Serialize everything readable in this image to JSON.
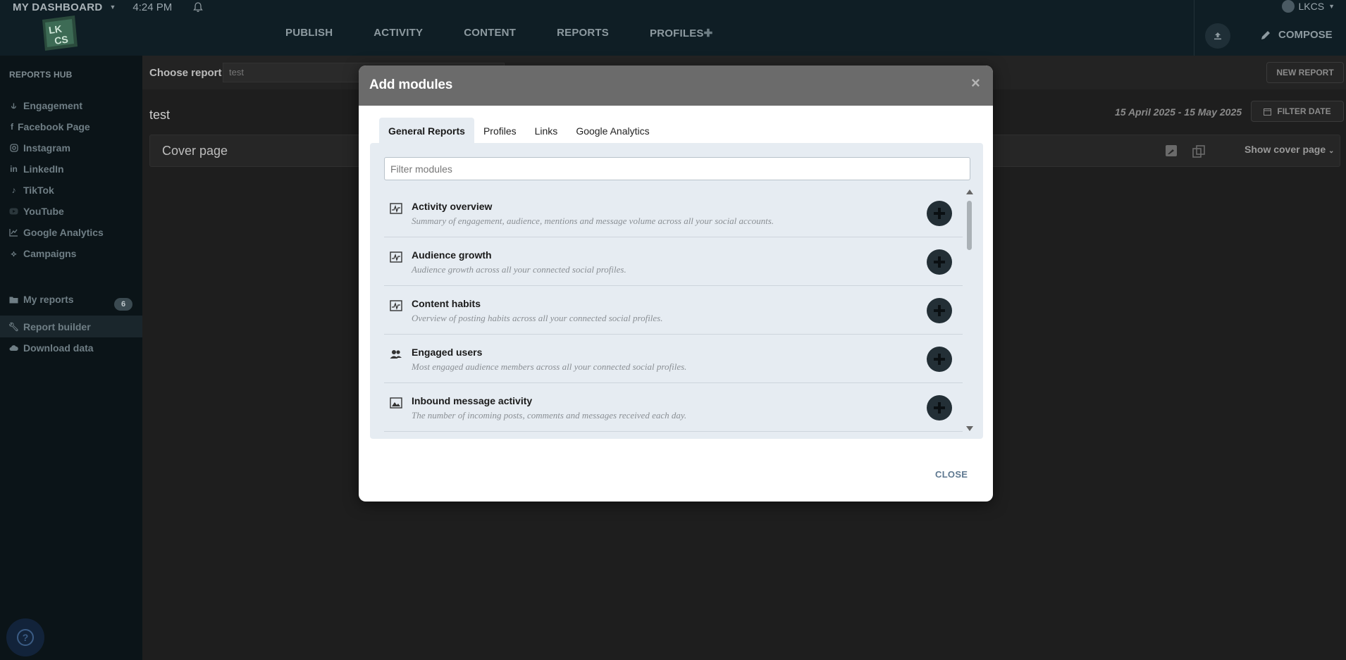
{
  "topbar": {
    "dashboard_label": "MY DASHBOARD",
    "time": "4:24 PM",
    "user": "LKCS",
    "compose_label": "COMPOSE",
    "nav": [
      {
        "label": "PUBLISH"
      },
      {
        "label": "ACTIVITY"
      },
      {
        "label": "CONTENT"
      },
      {
        "label": "REPORTS"
      },
      {
        "label": "PROFILES"
      }
    ]
  },
  "sidebar": {
    "heading": "REPORTS HUB",
    "items": [
      {
        "label": "Engagement",
        "icon": "engagement-icon"
      },
      {
        "label": "Facebook Page",
        "icon": "facebook-icon"
      },
      {
        "label": "Instagram",
        "icon": "instagram-icon"
      },
      {
        "label": "LinkedIn",
        "icon": "linkedin-icon"
      },
      {
        "label": "TikTok",
        "icon": "tiktok-icon"
      },
      {
        "label": "YouTube",
        "icon": "youtube-icon"
      },
      {
        "label": "Google Analytics",
        "icon": "chart-icon"
      },
      {
        "label": "Campaigns",
        "icon": "campaign-icon"
      }
    ],
    "tools": [
      {
        "label": "My reports",
        "icon": "folder-icon",
        "badge": "6"
      },
      {
        "label": "Report builder",
        "icon": "wrench-icon"
      },
      {
        "label": "Download data",
        "icon": "cloud-download-icon"
      }
    ]
  },
  "main": {
    "choose_label": "Choose report",
    "choose_value": "test",
    "new_report_label": "NEW REPORT",
    "page_title": "test",
    "date_range": "15 April 2025 - 15 May 2025",
    "filter_date_label": "FILTER DATE",
    "cover_title": "Cover page",
    "show_cover_label": "Show cover page"
  },
  "modal": {
    "title": "Add modules",
    "tabs": [
      {
        "label": "General Reports"
      },
      {
        "label": "Profiles"
      },
      {
        "label": "Links"
      },
      {
        "label": "Google Analytics"
      }
    ],
    "filter_placeholder": "Filter modules",
    "modules": [
      {
        "title": "Activity overview",
        "desc": "Summary of engagement, audience, mentions and message volume across all your social accounts.",
        "icon": "pulse-chart-icon"
      },
      {
        "title": "Audience growth",
        "desc": "Audience growth across all your connected social profiles.",
        "icon": "pulse-chart-icon"
      },
      {
        "title": "Content habits",
        "desc": "Overview of posting habits across all your connected social profiles.",
        "icon": "pulse-chart-icon"
      },
      {
        "title": "Engaged users",
        "desc": "Most engaged audience members across all your connected social profiles.",
        "icon": "users-icon"
      },
      {
        "title": "Inbound message activity",
        "desc": "The number of incoming posts, comments and messages received each day.",
        "icon": "image-icon"
      }
    ],
    "close_label": "CLOSE"
  }
}
